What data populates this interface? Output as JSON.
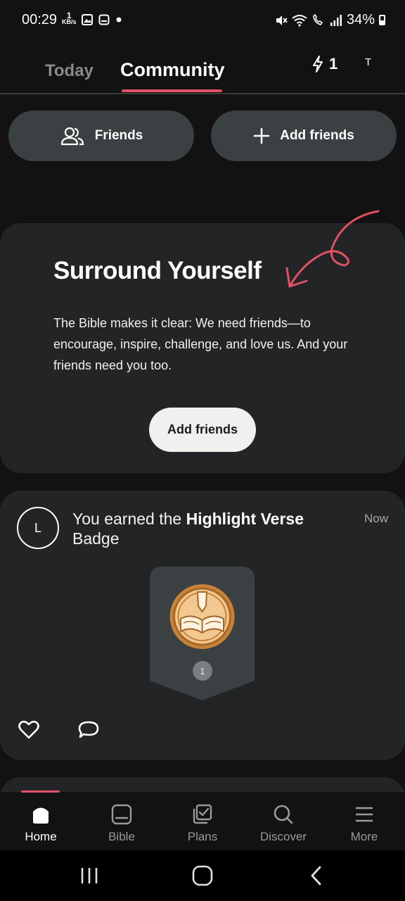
{
  "status_bar": {
    "time": "00:29",
    "net_speed_value": "1",
    "net_speed_unit": "KB/s",
    "battery": "34%"
  },
  "header": {
    "tabs": [
      {
        "label": "Today",
        "active": false
      },
      {
        "label": "Community",
        "active": true
      }
    ],
    "streak_count": "1",
    "avatar_initial": "T",
    "accent_color": "#e05263"
  },
  "friend_actions": {
    "friends_label": "Friends",
    "add_friends_label": "Add friends"
  },
  "surround_card": {
    "title": "Surround Yourself",
    "body": "The Bible makes it clear: We need friends—to encourage, inspire, challenge, and love us. And your friends need you too.",
    "button_label": "Add friends"
  },
  "activity": {
    "avatar_initial": "L",
    "text_prefix": "You earned the ",
    "badge_name": "Highlight Verse",
    "text_suffix": " Badge",
    "time": "Now",
    "badge_count": "1"
  },
  "bottom_nav": {
    "items": [
      {
        "label": "Home",
        "icon": "home-icon",
        "active": true
      },
      {
        "label": "Bible",
        "icon": "bible-icon",
        "active": false
      },
      {
        "label": "Plans",
        "icon": "plans-icon",
        "active": false
      },
      {
        "label": "Discover",
        "icon": "search-icon",
        "active": false
      },
      {
        "label": "More",
        "icon": "menu-icon",
        "active": false
      }
    ]
  }
}
